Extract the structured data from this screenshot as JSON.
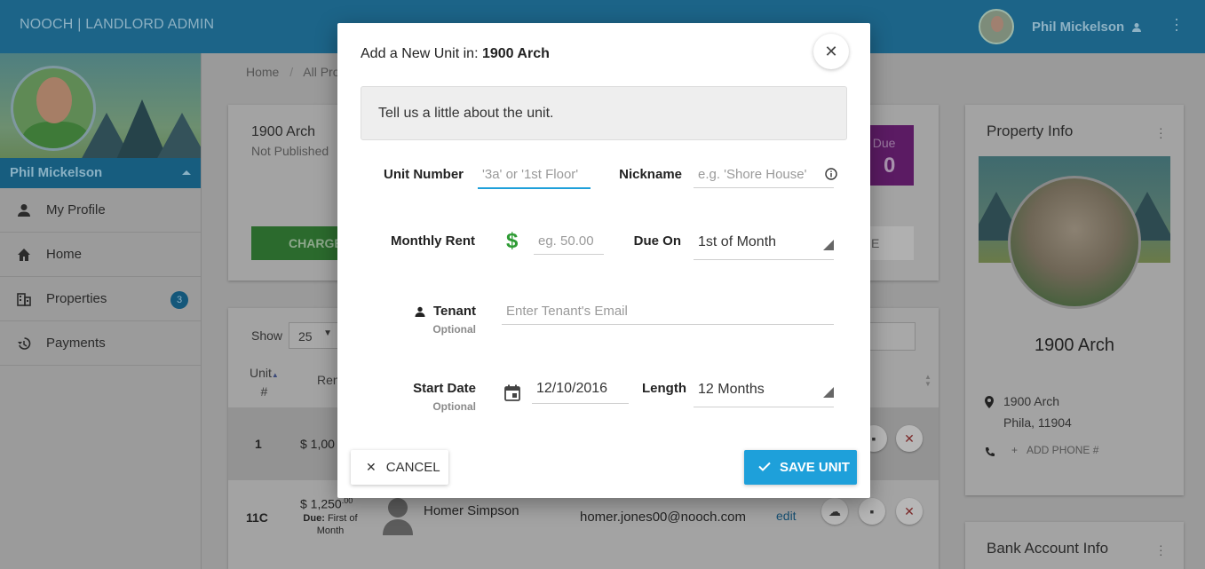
{
  "app": {
    "brand": "NOOCH | LANDLORD ADMIN",
    "user_name": "Phil Mickelson"
  },
  "sidebar": {
    "user_name": "Phil Mickelson",
    "items": [
      {
        "label": "My Profile",
        "icon": "person-icon"
      },
      {
        "label": "Home",
        "icon": "home-icon"
      },
      {
        "label": "Properties",
        "icon": "building-icon",
        "badge": "3"
      },
      {
        "label": "Payments",
        "icon": "history-icon"
      }
    ]
  },
  "breadcrumb": {
    "home": "Home",
    "sep": "/",
    "current": "All Pro"
  },
  "property": {
    "name": "1900 Arch",
    "status": "Not Published",
    "charge_label": "CHARGE",
    "due_label": "t Due",
    "due_value": "0",
    "ghost_label": "E"
  },
  "units_table": {
    "show_label": "Show",
    "page_size": "25",
    "headers": {
      "unit": "Unit #",
      "unit_line1": "Unit",
      "unit_line2": "#",
      "rent": "Ren"
    },
    "rows": [
      {
        "unit": "1",
        "rent": "$ 1,00"
      },
      {
        "unit": "11C",
        "rent": "$ 1,250",
        "rent_cents": ".00",
        "due_label": "Due:",
        "due_text": "First of Month",
        "tenant": "Homer Simpson",
        "email": "homer.jones00@nooch.com",
        "edit": "edit"
      }
    ]
  },
  "property_info": {
    "title": "Property Info",
    "name": "1900 Arch",
    "address_line1": "1900 Arch",
    "address_line2": "Phila, 11904",
    "add_phone": "ADD PHONE #",
    "add_plus": "+"
  },
  "bank_info": {
    "title": "Bank Account Info"
  },
  "modal": {
    "title_prefix": "Add a New Unit in:",
    "title_property": "1900 Arch",
    "intro": "Tell us a little about the unit.",
    "unit_number": {
      "label": "Unit Number",
      "placeholder": "'3a' or '1st Floor'",
      "value": ""
    },
    "nickname": {
      "label": "Nickname",
      "placeholder": "e.g. 'Shore House'",
      "value": ""
    },
    "monthly_rent": {
      "label": "Monthly Rent",
      "currency": "$",
      "placeholder": "eg. 50.00",
      "value": ""
    },
    "due_on": {
      "label": "Due On",
      "value": "1st of Month"
    },
    "tenant": {
      "label": "Tenant",
      "optional": "Optional",
      "placeholder": "Enter Tenant's Email",
      "value": ""
    },
    "start_date": {
      "label": "Start Date",
      "optional": "Optional",
      "value": "12/10/2016"
    },
    "length": {
      "label": "Length",
      "value": "12 Months"
    },
    "cancel_label": "CANCEL",
    "save_label": "SAVE UNIT",
    "accent_color": "#1ea0da",
    "rent_color": "#2e9b34"
  }
}
